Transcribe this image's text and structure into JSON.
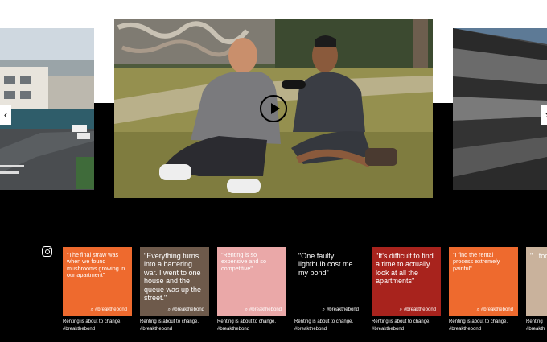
{
  "carousel": {
    "prev_arrow": "‹",
    "next_arrow": "›",
    "play_icon": "play-icon"
  },
  "instagram": {
    "icon": "instagram-icon",
    "posts": [
      {
        "quote": "\"The final straw was when we found mushrooms growing in our apartment\"",
        "hashtag": "#breakthebond",
        "caption_line1": "Renting is about to change.",
        "caption_line2": "#breakthebond",
        "bg": "#ee6a2e",
        "fg": "#ffffff",
        "big": false
      },
      {
        "quote": "\"Everything turns into a bartering war. I went to one house and the queue was up the street.\"",
        "hashtag": "#breakthebond",
        "caption_line1": "Renting is about to change.",
        "caption_line2": "#breakthebond",
        "bg": "#6e5a4b",
        "fg": "#ffffff",
        "big": true
      },
      {
        "quote": "\"Renting is so expensive and so competitive\"",
        "hashtag": "#breakthebond",
        "caption_line1": "Renting is about to change.",
        "caption_line2": "#breakthebond",
        "bg": "#eaa8a8",
        "fg": "#ffffff",
        "big": false
      },
      {
        "quote": "\"One faulty lightbulb cost me my bond\"",
        "hashtag": "#breakthebond",
        "caption_line1": "Renting is about to change.",
        "caption_line2": "#breakthebond",
        "bg": "#000000",
        "fg": "#ffffff",
        "big": true
      },
      {
        "quote": "\"It's difficult to find a time to actually look at all the apartments\"",
        "hashtag": "#breakthebond",
        "caption_line1": "Renting is about to change.",
        "caption_line2": "#breakthebond",
        "bg": "#a8231d",
        "fg": "#ffffff",
        "big": true
      },
      {
        "quote": "\"I find the rental process extremely painful\"",
        "hashtag": "#breakthebond",
        "caption_line1": "Renting is about to change.",
        "caption_line2": "#breakthebond",
        "bg": "#ee6a2e",
        "fg": "#ffffff",
        "big": false
      },
      {
        "quote": "\"...too y... bothe...",
        "hashtag": "",
        "caption_line1": "Renting",
        "caption_line2": "#breakth",
        "bg": "#c9b29c",
        "fg": "#ffffff",
        "big": true
      }
    ]
  }
}
